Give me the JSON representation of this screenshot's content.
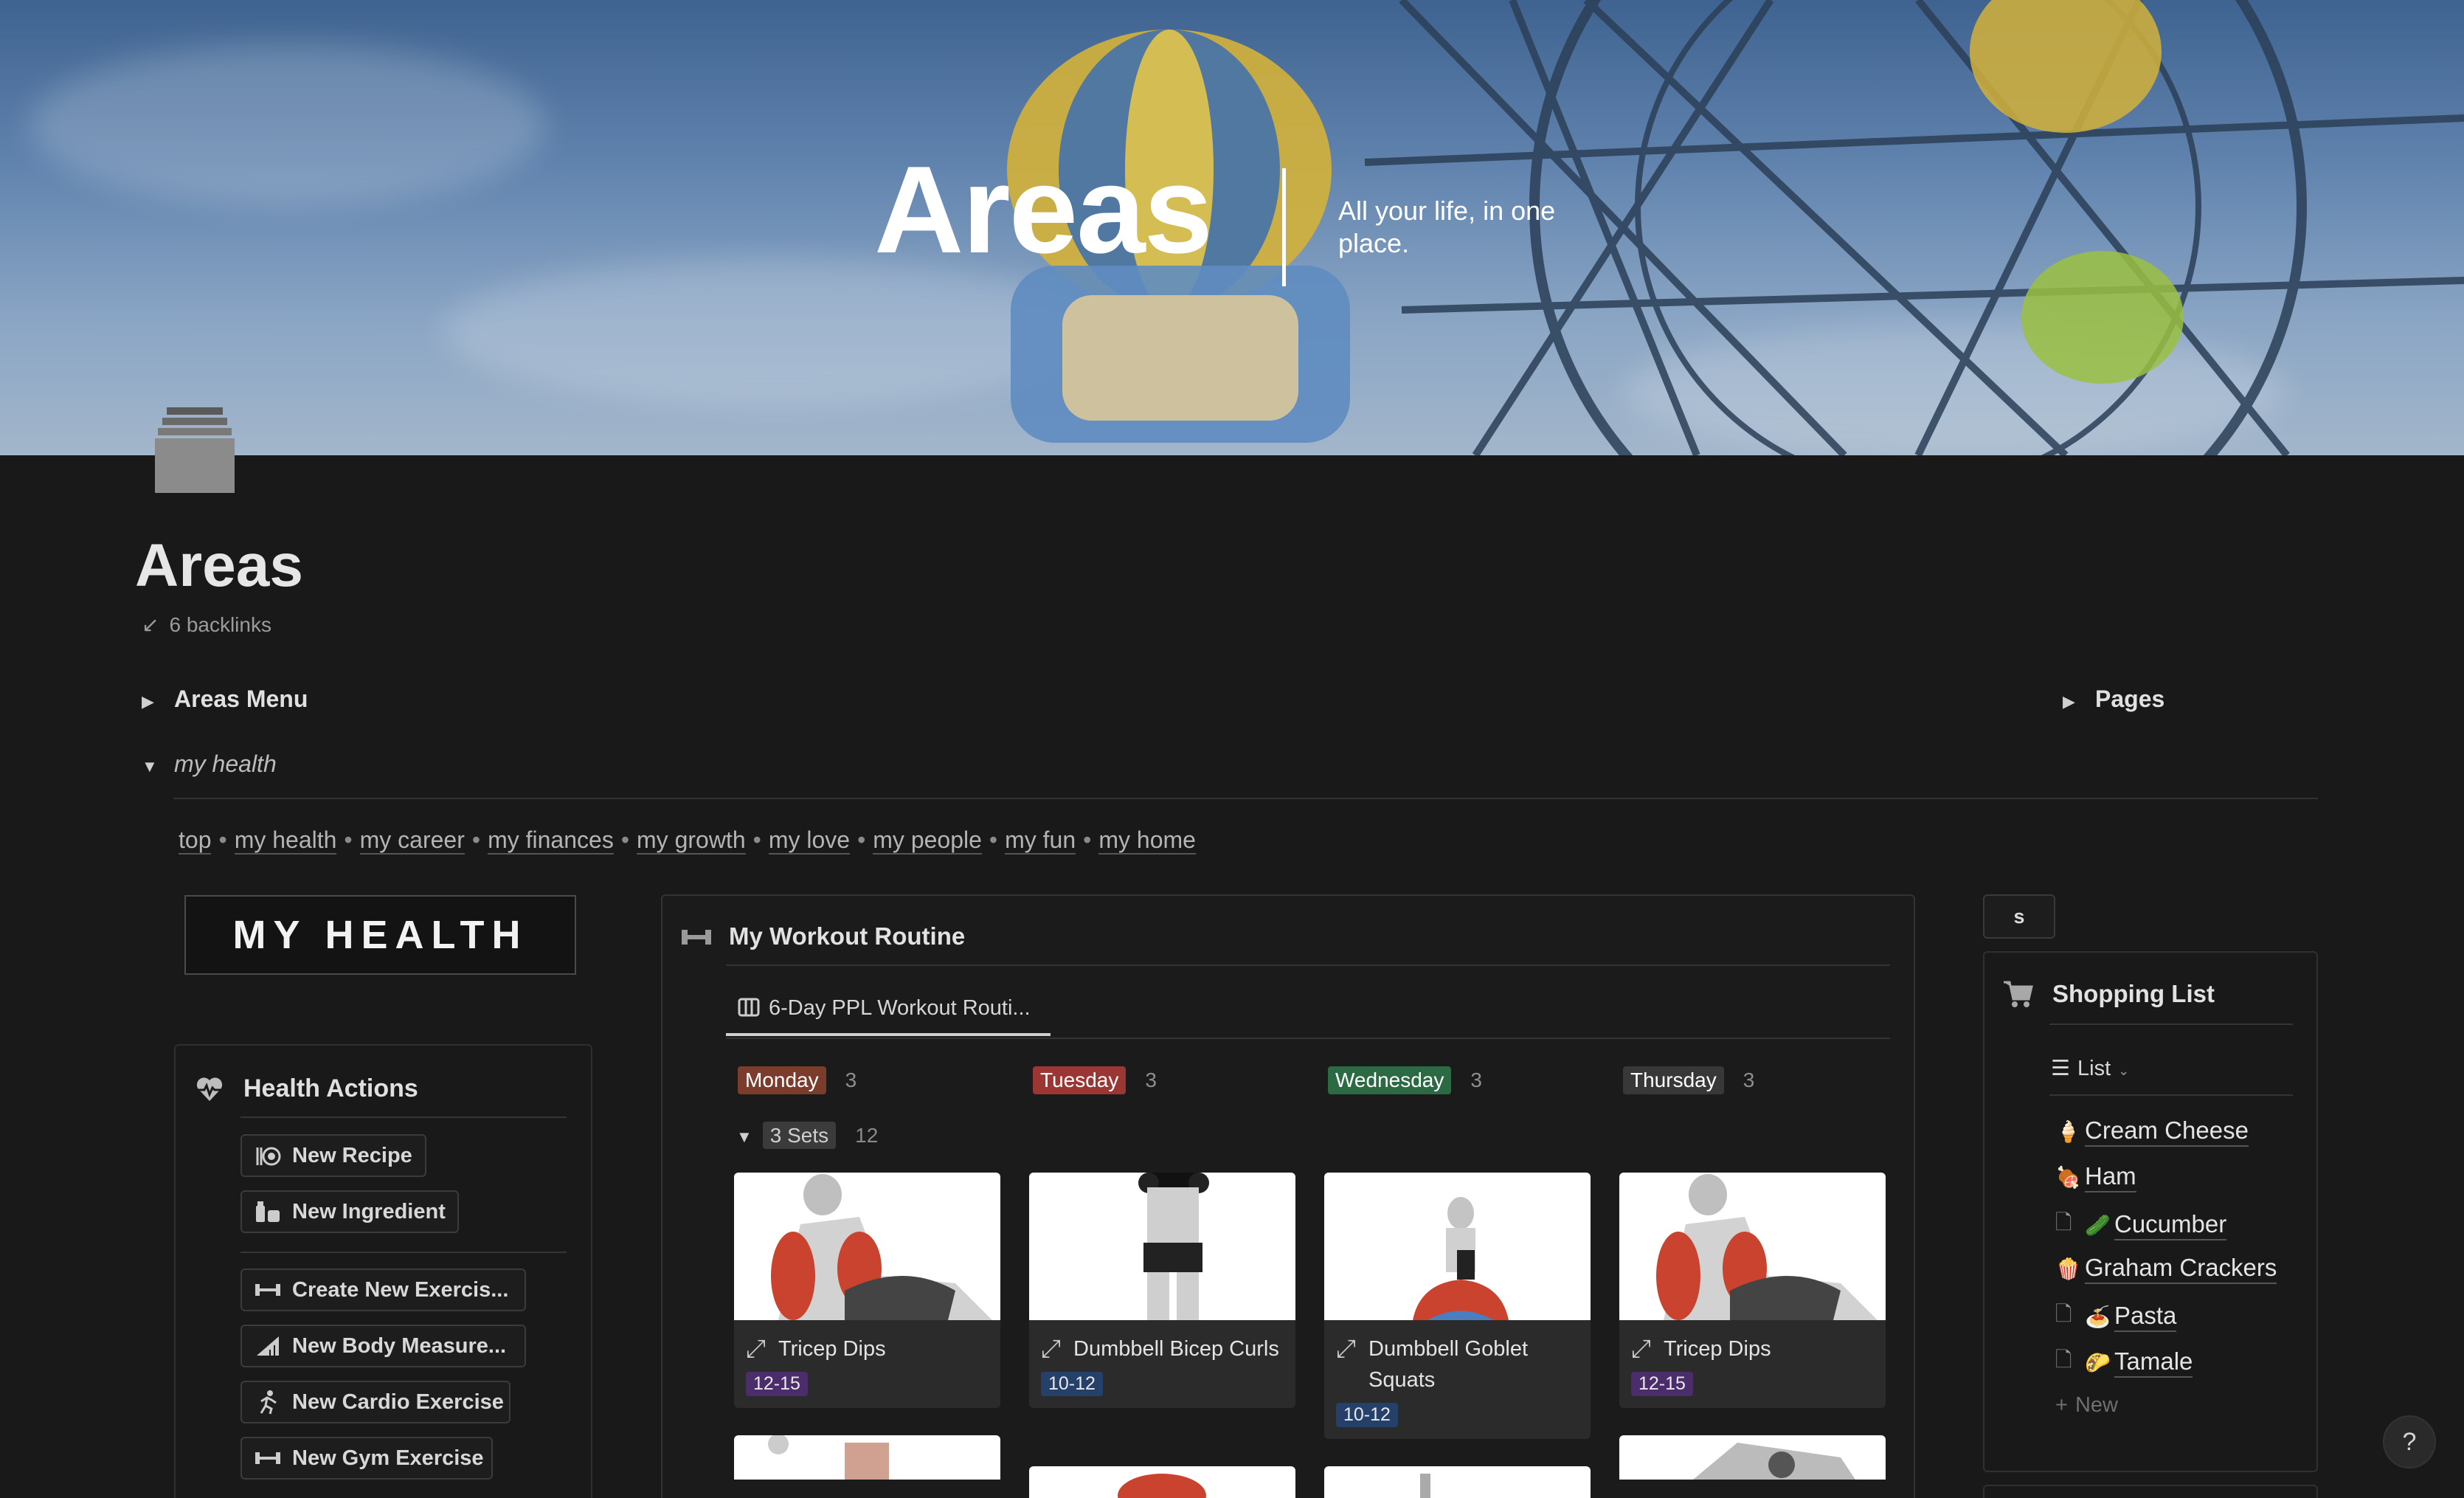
{
  "cover": {
    "title": "Areas",
    "tagline": "All your life, in one place."
  },
  "page": {
    "title": "Areas",
    "backlinks": "6 backlinks"
  },
  "toggles": {
    "areas_menu": "Areas Menu",
    "pages": "Pages",
    "my_health": "my health"
  },
  "nav": {
    "items": [
      "top",
      "my health",
      "my career",
      "my finances",
      "my growth",
      "my love",
      "my people",
      "my fun",
      "my home"
    ]
  },
  "health_banner": "MY HEALTH",
  "health_actions": {
    "title": "Health Actions",
    "buttons": [
      "New Recipe",
      "New Ingredient",
      "Create New Exercis...",
      "New Body Measure...",
      "New Cardio Exercise",
      "New Gym Exercise"
    ]
  },
  "workout": {
    "title": "My Workout Routine",
    "view_tab": "6-Day PPL Workout Routi...",
    "group": {
      "label": "3 Sets",
      "count": "12"
    },
    "columns": [
      {
        "day": "Monday",
        "count": "3",
        "color": "#8a3f2f",
        "bg": "#1e1e1e",
        "card": {
          "name": "Tricep Dips",
          "reps": "12-15",
          "reps_color": "#4b2d6b"
        }
      },
      {
        "day": "Tuesday",
        "count": "3",
        "color": "#a03a36",
        "bg": "#1e1e1e",
        "card": {
          "name": "Dumbbell Bicep Curls",
          "reps": "10-12",
          "reps_color": "#25416a"
        }
      },
      {
        "day": "Wednesday",
        "count": "3",
        "color": "#2f6b45",
        "bg": "#1e1e1e",
        "card": {
          "name": "Dumbbell Goblet Squats",
          "reps": "10-12",
          "reps_color": "#25416a"
        }
      },
      {
        "day": "Thursday",
        "count": "3",
        "color": "#3a3a3a",
        "bg": "#1e1e1e",
        "card": {
          "name": "Tricep Dips",
          "reps": "12-15",
          "reps_color": "#4b2d6b"
        }
      }
    ]
  },
  "s_button": "s",
  "shopping": {
    "title": "Shopping List",
    "view": "List",
    "items": [
      {
        "emoji": "🍦",
        "name": "Cream Cheese"
      },
      {
        "emoji": "🍖",
        "name": "Ham"
      },
      {
        "emoji": "🥒",
        "name": "Cucumber",
        "doc": true
      },
      {
        "emoji": "🍿",
        "name": "Graham Crackers"
      },
      {
        "emoji": "🍝",
        "name": "Pasta",
        "doc": true
      },
      {
        "emoji": "🌮",
        "name": "Tamale",
        "doc": true
      }
    ],
    "new_label": "New"
  },
  "help": "?"
}
